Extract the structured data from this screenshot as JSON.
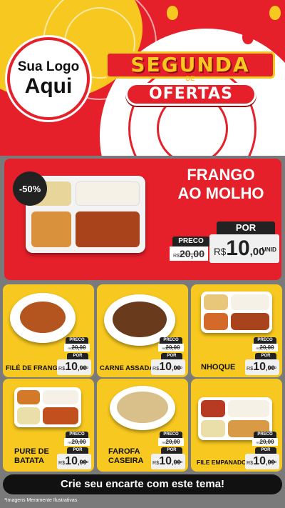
{
  "logo": {
    "line1": "Sua Logo",
    "line2": "Aqui"
  },
  "title": {
    "line1": "SEGUNDA",
    "connector": "DE",
    "line2": "OFERTAS"
  },
  "featured": {
    "discount_badge": "-50%",
    "name_line1": "FRANGO",
    "name_line2": "AO MOLHO",
    "preco_label": "PRECO",
    "old_currency": "R$",
    "old_price": "20,00",
    "por_label": "POR",
    "new_currency": "R$",
    "new_int": "10",
    "new_dec": ",00",
    "unit": "UNID"
  },
  "products": [
    {
      "name": "FILÉ DE FRANGO",
      "preco_label": "PRECO",
      "old_currency": "R$",
      "old_price": "20,00",
      "por_label": "POR",
      "new_currency": "R$",
      "new_int": "10",
      "new_dec": ",00",
      "unit": "UNID"
    },
    {
      "name": "CARNE ASSADA",
      "preco_label": "PRECO",
      "old_currency": "R$",
      "old_price": "20,00",
      "por_label": "POR",
      "new_currency": "R$",
      "new_int": "10",
      "new_dec": ",00",
      "unit": "UNID"
    },
    {
      "name": "NHOQUE",
      "preco_label": "PRECO",
      "old_currency": "R$",
      "old_price": "20,00",
      "por_label": "POR",
      "new_currency": "R$",
      "new_int": "10",
      "new_dec": ",00",
      "unit": "UNID"
    },
    {
      "name_line1": "PURE DE",
      "name_line2": "BATATA",
      "preco_label": "PRECO",
      "old_currency": "R$",
      "old_price": "20,00",
      "por_label": "POR",
      "new_currency": "R$",
      "new_int": "10",
      "new_dec": ",00",
      "unit": "UNID"
    },
    {
      "name_line1": "FAROFA",
      "name_line2": "CASEIRA",
      "preco_label": "PRECO",
      "old_currency": "R$",
      "old_price": "20,00",
      "por_label": "POR",
      "new_currency": "R$",
      "new_int": "10",
      "new_dec": ",00",
      "unit": "UNID"
    },
    {
      "name": "FILE EMPANADO",
      "preco_label": "PRECO",
      "old_currency": "R$",
      "old_price": "20,00",
      "por_label": "POR",
      "new_currency": "R$",
      "new_int": "10",
      "new_dec": ",00",
      "unit": "UNID"
    }
  ],
  "cta": "Crie seu encarte com este tema!",
  "disclaimer": "*Imagens Meramente Ilustrativas",
  "colors": {
    "red": "#e5202a",
    "yellow": "#f7c81f",
    "dark": "#111111"
  }
}
